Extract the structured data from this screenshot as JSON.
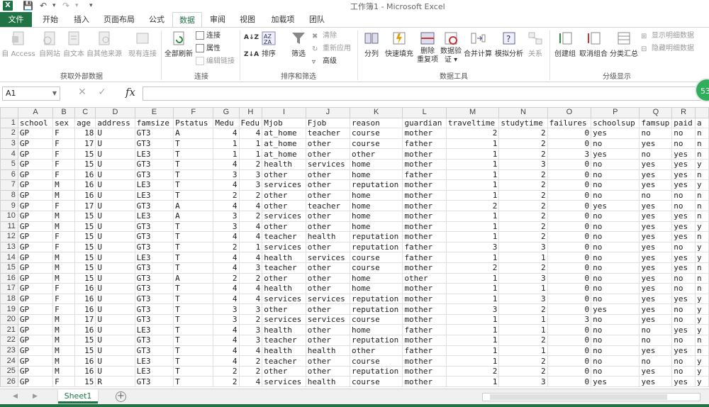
{
  "app": {
    "logo": "X",
    "title": "工作簿1 - Microsoft Excel",
    "accent": "#217346"
  },
  "quick_access": {
    "save_icon": "save-icon",
    "undo_icon": "undo-icon",
    "redo_icon": "redo-icon"
  },
  "tabs": {
    "file": "文件",
    "items": [
      "开始",
      "插入",
      "页面布局",
      "公式",
      "数据",
      "审阅",
      "视图",
      "加载项",
      "团队"
    ],
    "active": "数据"
  },
  "ribbon": {
    "external": {
      "access": "自 Access",
      "web": "自网站",
      "text": "自文本",
      "other": "自其他来源",
      "existing": "现有连接",
      "label": "获取外部数据"
    },
    "connections": {
      "refresh": "全部刷新",
      "connections": "连接",
      "properties": "属性",
      "edit_links": "编辑链接",
      "label": "连接"
    },
    "sort_filter": {
      "sort": "排序",
      "filter": "筛选",
      "clear": "清除",
      "reapply": "重新应用",
      "advanced": "高级",
      "label": "排序和筛选"
    },
    "tools": {
      "split": "分列",
      "flash_fill": "快速填充",
      "remove_dup": "删除\n重复项",
      "remove_dup_1": "删除",
      "remove_dup_2": "重复项",
      "validation_1": "数据验",
      "validation_2": "证 ▾",
      "consolidate": "合并计算",
      "what_if": "模拟分析",
      "relationships": "关系",
      "label": "数据工具"
    },
    "outline": {
      "group": "创建组",
      "ungroup": "取消组合",
      "subtotal": "分类汇总",
      "show_detail": "显示明细数据",
      "hide_detail": "隐藏明细数据",
      "label": "分级显示"
    }
  },
  "formula_bar": {
    "cell_ref": "A1",
    "fx": "fx",
    "value": ""
  },
  "badge": "53",
  "grid": {
    "columns": [
      "A",
      "B",
      "C",
      "D",
      "E",
      "F",
      "G",
      "H",
      "I",
      "J",
      "K",
      "L",
      "M",
      "N",
      "O",
      "P",
      "Q",
      "R",
      ""
    ],
    "header_row": [
      "school",
      "sex",
      "age",
      "address",
      "famsize",
      "Pstatus",
      "Medu",
      "Fedu",
      "Mjob",
      "Fjob",
      "reason",
      "guardian",
      "traveltime",
      "studytime",
      "failures",
      "schoolsup",
      "famsup",
      "paid",
      "a"
    ],
    "rows": [
      [
        "GP",
        "F",
        "18",
        "U",
        "GT3",
        "A",
        "4",
        "4",
        "at_home",
        "teacher",
        "course",
        "mother",
        "2",
        "2",
        "0",
        "yes",
        "no",
        "no",
        "n"
      ],
      [
        "GP",
        "F",
        "17",
        "U",
        "GT3",
        "T",
        "1",
        "1",
        "at_home",
        "other",
        "course",
        "father",
        "1",
        "2",
        "0",
        "no",
        "yes",
        "no",
        "n"
      ],
      [
        "GP",
        "F",
        "15",
        "U",
        "LE3",
        "T",
        "1",
        "1",
        "at_home",
        "other",
        "other",
        "mother",
        "1",
        "2",
        "3",
        "yes",
        "no",
        "yes",
        "n"
      ],
      [
        "GP",
        "F",
        "15",
        "U",
        "GT3",
        "T",
        "4",
        "2",
        "health",
        "services",
        "home",
        "mother",
        "1",
        "3",
        "0",
        "no",
        "yes",
        "yes",
        "y"
      ],
      [
        "GP",
        "F",
        "16",
        "U",
        "GT3",
        "T",
        "3",
        "3",
        "other",
        "other",
        "home",
        "father",
        "1",
        "2",
        "0",
        "no",
        "yes",
        "yes",
        "n"
      ],
      [
        "GP",
        "M",
        "16",
        "U",
        "LE3",
        "T",
        "4",
        "3",
        "services",
        "other",
        "reputation",
        "mother",
        "1",
        "2",
        "0",
        "no",
        "yes",
        "yes",
        "y"
      ],
      [
        "GP",
        "M",
        "16",
        "U",
        "LE3",
        "T",
        "2",
        "2",
        "other",
        "other",
        "home",
        "mother",
        "1",
        "2",
        "0",
        "no",
        "no",
        "no",
        "n"
      ],
      [
        "GP",
        "F",
        "17",
        "U",
        "GT3",
        "A",
        "4",
        "4",
        "other",
        "teacher",
        "home",
        "mother",
        "2",
        "2",
        "0",
        "yes",
        "yes",
        "no",
        "n"
      ],
      [
        "GP",
        "M",
        "15",
        "U",
        "LE3",
        "A",
        "3",
        "2",
        "services",
        "other",
        "home",
        "mother",
        "1",
        "2",
        "0",
        "no",
        "yes",
        "yes",
        "n"
      ],
      [
        "GP",
        "M",
        "15",
        "U",
        "GT3",
        "T",
        "3",
        "4",
        "other",
        "other",
        "home",
        "mother",
        "1",
        "2",
        "0",
        "no",
        "yes",
        "yes",
        "y"
      ],
      [
        "GP",
        "F",
        "15",
        "U",
        "GT3",
        "T",
        "4",
        "4",
        "teacher",
        "health",
        "reputation",
        "mother",
        "1",
        "2",
        "0",
        "no",
        "yes",
        "yes",
        "n"
      ],
      [
        "GP",
        "F",
        "15",
        "U",
        "GT3",
        "T",
        "2",
        "1",
        "services",
        "other",
        "reputation",
        "father",
        "3",
        "3",
        "0",
        "no",
        "yes",
        "no",
        "y"
      ],
      [
        "GP",
        "M",
        "15",
        "U",
        "LE3",
        "T",
        "4",
        "4",
        "health",
        "services",
        "course",
        "father",
        "1",
        "1",
        "0",
        "no",
        "yes",
        "yes",
        "y"
      ],
      [
        "GP",
        "M",
        "15",
        "U",
        "GT3",
        "T",
        "4",
        "3",
        "teacher",
        "other",
        "course",
        "mother",
        "2",
        "2",
        "0",
        "no",
        "yes",
        "yes",
        "n"
      ],
      [
        "GP",
        "M",
        "15",
        "U",
        "GT3",
        "A",
        "2",
        "2",
        "other",
        "other",
        "home",
        "other",
        "1",
        "3",
        "0",
        "no",
        "yes",
        "no",
        "n"
      ],
      [
        "GP",
        "F",
        "16",
        "U",
        "GT3",
        "T",
        "4",
        "4",
        "health",
        "other",
        "home",
        "mother",
        "1",
        "1",
        "0",
        "no",
        "yes",
        "no",
        "n"
      ],
      [
        "GP",
        "F",
        "16",
        "U",
        "GT3",
        "T",
        "4",
        "4",
        "services",
        "services",
        "reputation",
        "mother",
        "1",
        "3",
        "0",
        "no",
        "yes",
        "yes",
        "y"
      ],
      [
        "GP",
        "F",
        "16",
        "U",
        "GT3",
        "T",
        "3",
        "3",
        "other",
        "other",
        "reputation",
        "mother",
        "3",
        "2",
        "0",
        "yes",
        "yes",
        "no",
        "y"
      ],
      [
        "GP",
        "M",
        "17",
        "U",
        "GT3",
        "T",
        "3",
        "2",
        "services",
        "services",
        "course",
        "mother",
        "1",
        "1",
        "3",
        "no",
        "yes",
        "no",
        "y"
      ],
      [
        "GP",
        "M",
        "16",
        "U",
        "LE3",
        "T",
        "4",
        "3",
        "health",
        "other",
        "home",
        "father",
        "1",
        "1",
        "0",
        "no",
        "no",
        "yes",
        "y"
      ],
      [
        "GP",
        "M",
        "15",
        "U",
        "GT3",
        "T",
        "4",
        "3",
        "teacher",
        "other",
        "reputation",
        "mother",
        "1",
        "2",
        "0",
        "no",
        "no",
        "no",
        "n"
      ],
      [
        "GP",
        "M",
        "15",
        "U",
        "GT3",
        "T",
        "4",
        "4",
        "health",
        "health",
        "other",
        "father",
        "1",
        "1",
        "0",
        "no",
        "yes",
        "yes",
        "n"
      ],
      [
        "GP",
        "M",
        "16",
        "U",
        "LE3",
        "T",
        "4",
        "2",
        "teacher",
        "other",
        "course",
        "mother",
        "1",
        "2",
        "0",
        "no",
        "no",
        "no",
        "y"
      ],
      [
        "GP",
        "M",
        "16",
        "U",
        "LE3",
        "T",
        "2",
        "2",
        "other",
        "other",
        "reputation",
        "mother",
        "2",
        "2",
        "0",
        "no",
        "yes",
        "no",
        "y"
      ],
      [
        "GP",
        "F",
        "15",
        "R",
        "GT3",
        "T",
        "2",
        "4",
        "services",
        "health",
        "course",
        "mother",
        "1",
        "3",
        "0",
        "yes",
        "yes",
        "yes",
        "y"
      ]
    ]
  },
  "sheets": {
    "active": "Sheet1",
    "add": "+"
  }
}
